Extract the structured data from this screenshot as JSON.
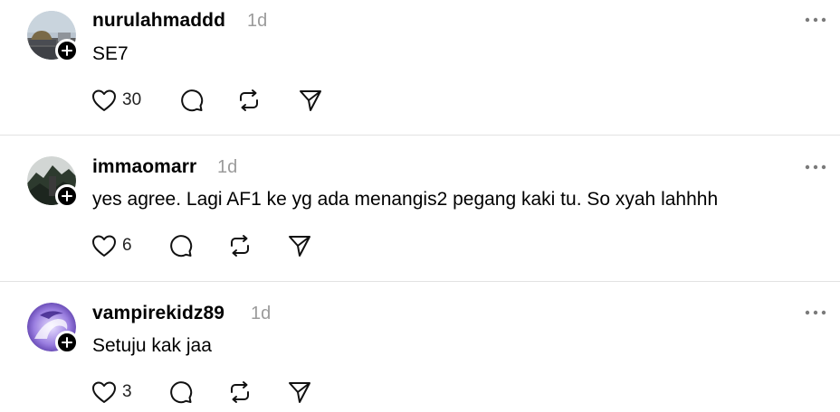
{
  "posts": [
    {
      "username": "nurulahmaddd",
      "time": "1d",
      "text": "SE7",
      "likes": "30",
      "avatar_icon": "mosque-photo-avatar"
    },
    {
      "username": "immaomarr",
      "time": "1d",
      "text": "yes agree. Lagi AF1 ke yg ada menangis2 pegang kaki tu. So xyah lahhhh",
      "likes": "6",
      "avatar_icon": "mountain-photo-avatar"
    },
    {
      "username": "vampirekidz89",
      "time": "1d",
      "text": "Setuju kak jaa",
      "likes": "3",
      "avatar_icon": "purple-dragon-avatar"
    }
  ],
  "colors": {
    "text": "#000000",
    "muted": "#9b9b9b",
    "divider": "#e2e2e2"
  }
}
